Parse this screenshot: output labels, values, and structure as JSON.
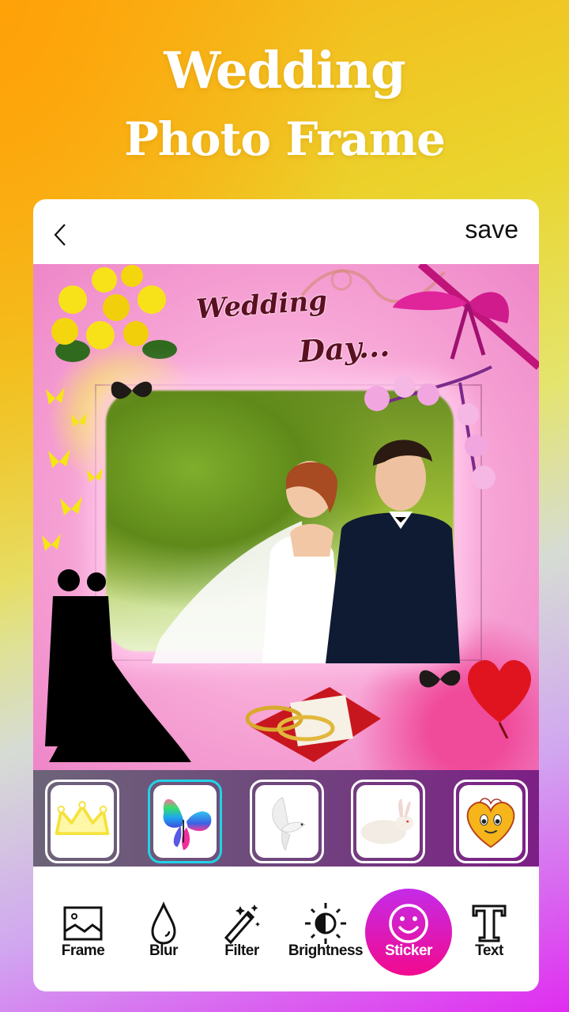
{
  "hero": {
    "title_line1": "Wedding",
    "title_line2": "Photo Frame"
  },
  "topbar": {
    "back_icon": "chevron-left-icon",
    "save_label": "save"
  },
  "canvas": {
    "overlay_text_line1": "Wedding",
    "overlay_text_line2": "Day..."
  },
  "stickers": [
    {
      "name": "crown",
      "icon": "crown-icon",
      "selected": false
    },
    {
      "name": "butterfly",
      "icon": "butterfly-icon",
      "selected": true
    },
    {
      "name": "dove",
      "icon": "dove-icon",
      "selected": false
    },
    {
      "name": "rabbit",
      "icon": "rabbit-icon",
      "selected": false
    },
    {
      "name": "heart-face",
      "icon": "heart-smiley-icon",
      "selected": false
    }
  ],
  "toolbar": {
    "items": [
      {
        "label": "Frame",
        "icon": "image-frame-icon"
      },
      {
        "label": "Blur",
        "icon": "drop-icon"
      },
      {
        "label": "Filter",
        "icon": "magic-wand-icon"
      },
      {
        "label": "Brightness",
        "icon": "brightness-icon"
      },
      {
        "label": "Sticker",
        "icon": "smiley-icon",
        "active": true
      },
      {
        "label": "Text",
        "icon": "text-icon"
      }
    ]
  },
  "colors": {
    "active_tool_gradient_top": "#c52be8",
    "active_tool_gradient_bottom": "#f20a8e",
    "selected_sticker_border": "#20d4e6",
    "sticker_strip_left": "#6d6479",
    "sticker_strip_right": "#7d1f86"
  }
}
